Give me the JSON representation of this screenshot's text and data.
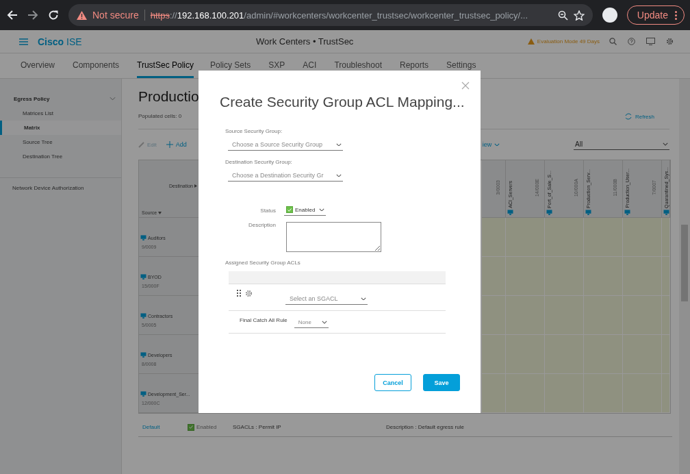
{
  "browser": {
    "security": "Not secure",
    "url": [
      "https",
      "://",
      "192.168.100.201",
      "/admin/#workcenters/workcenter_trustsec/workcenter_trustsec_policy/..."
    ],
    "update": "Update"
  },
  "app": {
    "brand": "Cisco",
    "product": "ISE",
    "breadcrumb": "Work Centers • TrustSec",
    "evaluation": "Evaluation Mode 49 Days"
  },
  "tabs": [
    {
      "label": "Overview",
      "selected": false
    },
    {
      "label": "Components",
      "selected": false
    },
    {
      "label": "TrustSec Policy",
      "selected": true
    },
    {
      "label": "Policy Sets",
      "selected": false
    },
    {
      "label": "SXP",
      "selected": false
    },
    {
      "label": "ACI",
      "selected": false
    },
    {
      "label": "Troubleshoot",
      "selected": false
    },
    {
      "label": "Reports",
      "selected": false
    },
    {
      "label": "Settings",
      "selected": false
    }
  ],
  "sidebar": {
    "group": {
      "label": "Egress Policy",
      "expanded": true,
      "items": [
        {
          "label": "Matrices List",
          "selected": false
        },
        {
          "label": "Matrix",
          "selected": true
        },
        {
          "label": "Source Tree",
          "selected": false
        },
        {
          "label": "Destination Tree",
          "selected": false
        }
      ]
    },
    "links": [
      "Network Device Authorization"
    ]
  },
  "content": {
    "title": "Productio",
    "populated": "Populated cells: 0",
    "refresh": "Refresh",
    "edit": "Edit",
    "add": "Add",
    "view": "iew",
    "filter": "All"
  },
  "matrix": {
    "destination": "Destination",
    "source": "Source",
    "columns": [
      {
        "id": "3/0003"
      },
      {
        "name": "ACI_Servers",
        "id": "14/000E"
      },
      {
        "name": "Port_of_Sale_S...",
        "id": "10/000A"
      },
      {
        "name": "Production_Serv...",
        "id": "11/000B"
      },
      {
        "name": "Production_User...",
        "id": "7/0007"
      },
      {
        "name": "Quarantined_Sys..."
      }
    ],
    "rows": [
      {
        "name": "Auditors",
        "id": "9/0009"
      },
      {
        "name": "BYOD",
        "id": "15/000F"
      },
      {
        "name": "Contractors",
        "id": "5/0005"
      },
      {
        "name": "Developers",
        "id": "8/0008"
      },
      {
        "name": "Development_Ser...",
        "id": "12/000C"
      }
    ]
  },
  "default_rule": {
    "label": "Default",
    "status": "Enabled",
    "enabled": true,
    "sgacls": "SGACLs : Permit IP",
    "description": "Description : Default egress rule"
  },
  "dialog": {
    "title": "Create Security Group ACL Mapping...",
    "source_label": "Source Security Group:",
    "source_placeholder": "Choose a Source Security Group",
    "destination_label": "Destination Security Group:",
    "destination_placeholder": "Choose a Destination Security Gr",
    "status_label": "Status",
    "status": "Enabled",
    "status_enabled": true,
    "description_label": "Description",
    "acls_label": "Assigned Security Group ACLs",
    "sgacl_placeholder": "Select an SGACL",
    "catch_all_label": "Final Catch All Rule",
    "catch_all": "None",
    "cancel": "Cancel",
    "save": "Save"
  }
}
